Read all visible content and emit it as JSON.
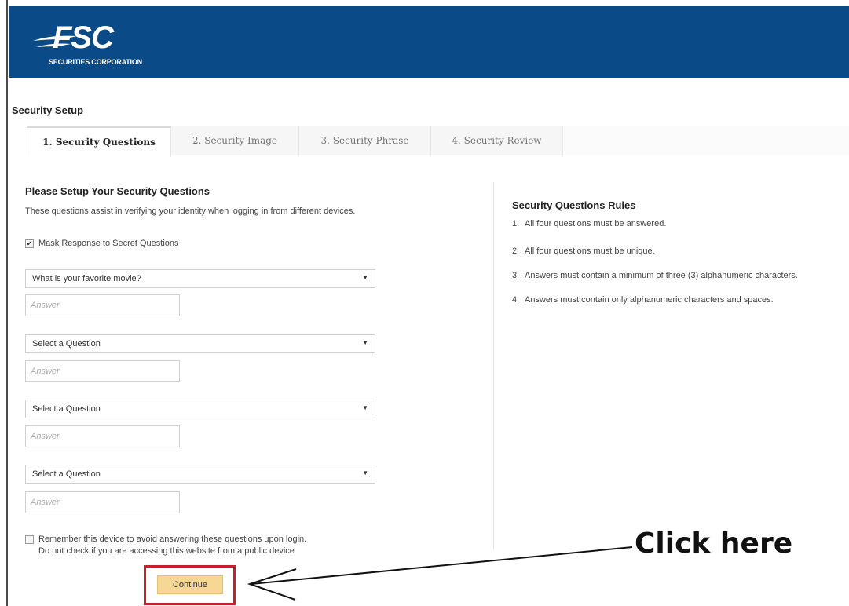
{
  "header": {
    "logo_text": "FSC",
    "logo_subtitle": "SECURITIES CORPORATION",
    "bg_color": "#0a4a86"
  },
  "page": {
    "section_title": "Security Setup"
  },
  "tabs": [
    {
      "label": "1. Security Questions",
      "active": true
    },
    {
      "label": "2. Security Image",
      "active": false
    },
    {
      "label": "3. Security Phrase",
      "active": false
    },
    {
      "label": "4. Security Review",
      "active": false
    }
  ],
  "form": {
    "heading": "Please Setup Your Security Questions",
    "description": "These questions assist in verifying your identity when logging in from different devices.",
    "mask_label": "Mask Response to Secret Questions",
    "mask_checked": true,
    "questions": [
      {
        "selected": "What is your favorite movie?",
        "answer_placeholder": "Answer"
      },
      {
        "selected": "Select a Question",
        "answer_placeholder": "Answer"
      },
      {
        "selected": "Select a Question",
        "answer_placeholder": "Answer"
      },
      {
        "selected": "Select a Question",
        "answer_placeholder": "Answer"
      }
    ],
    "remember_line1": "Remember this device to avoid answering these questions upon login.",
    "remember_line2": "Do not check if you are accessing this website from a public device",
    "remember_checked": false,
    "continue_label": "Continue",
    "continue_color": "#f7d794"
  },
  "rules": {
    "title": "Security Questions Rules",
    "items": [
      {
        "num": "1.",
        "text": "All four questions must be answered."
      },
      {
        "num": "2.",
        "text": "All four questions must be unique."
      },
      {
        "num": "3.",
        "text": "Answers must contain a minimum of three (3) alphanumeric characters."
      },
      {
        "num": "4.",
        "text": "Answers must contain only alphanumeric characters and spaces."
      }
    ]
  },
  "annotation": {
    "label": "Click here",
    "highlight_color": "#c8202a"
  }
}
